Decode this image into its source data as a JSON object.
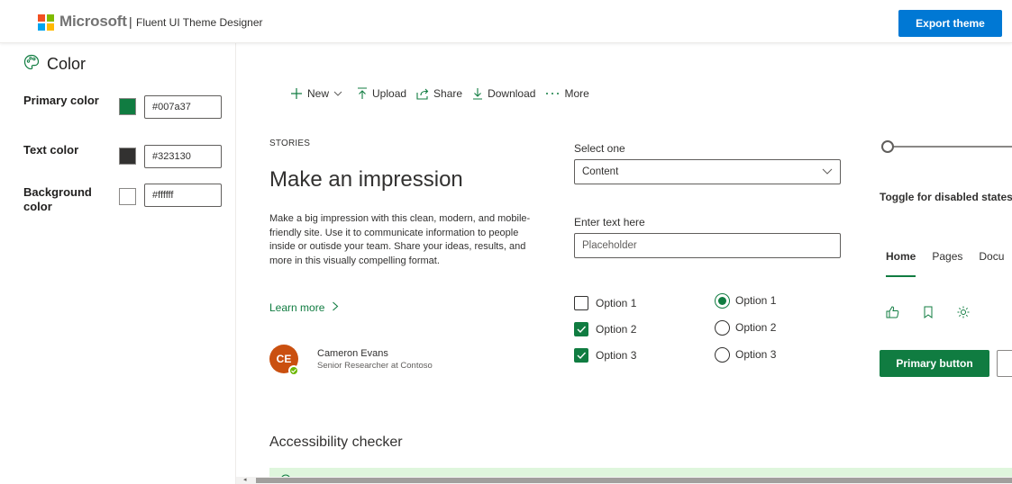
{
  "header": {
    "brand": "Microsoft",
    "separator": "|",
    "app_title": "Fluent UI Theme Designer",
    "export_label": "Export theme"
  },
  "sidebar": {
    "title": "Color",
    "rows": [
      {
        "label": "Primary color",
        "value": "#007a37",
        "swatch": "#107c41"
      },
      {
        "label": "Text color",
        "value": "#323130",
        "swatch": "#323130"
      },
      {
        "label": "Background color",
        "value": "#ffffff",
        "swatch": "#ffffff"
      }
    ]
  },
  "command_bar": {
    "items": [
      {
        "label": "New",
        "icon": "plus-icon"
      },
      {
        "label": "Upload",
        "icon": "upload-icon"
      },
      {
        "label": "Share",
        "icon": "share-icon"
      },
      {
        "label": "Download",
        "icon": "download-icon"
      },
      {
        "label": "More",
        "icon": "more-icon"
      }
    ]
  },
  "story": {
    "eyebrow": "STORIES",
    "headline": "Make an impression",
    "body": "Make a big impression with this clean, modern, and mobile-friendly site. Use it to communicate information to people inside or outisde your team. Share your ideas, results, and more in this visually compelling format.",
    "link": "Learn more",
    "persona": {
      "initials": "CE",
      "name": "Cameron Evans",
      "title": "Senior Researcher at Contoso"
    }
  },
  "form": {
    "select_label": "Select one",
    "select_value": "Content",
    "text_label": "Enter text here",
    "text_placeholder": "Placeholder",
    "checkboxes": [
      {
        "label": "Option 1",
        "checked": false
      },
      {
        "label": "Option 2",
        "checked": true
      },
      {
        "label": "Option 3",
        "checked": true
      }
    ],
    "radios": [
      {
        "label": "Option 1",
        "checked": true
      },
      {
        "label": "Option 2",
        "checked": false
      },
      {
        "label": "Option 3",
        "checked": false
      }
    ]
  },
  "controls": {
    "toggle_label": "Toggle for disabled states",
    "slider_value": 0,
    "pivot_tabs": [
      "Home",
      "Pages",
      "Docu"
    ],
    "primary_button": "Primary button"
  },
  "accessibility": {
    "title": "Accessibility checker"
  },
  "colors": {
    "accent": "#107c41",
    "header_button": "#0078d4",
    "avatar": "#ca5010",
    "banner": "#dff6dd"
  }
}
